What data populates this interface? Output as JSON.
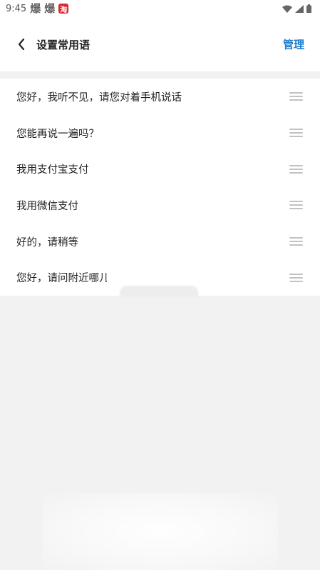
{
  "status_bar": {
    "time": "9:45",
    "notif_1": "爆",
    "notif_2": "爆",
    "notif_3": "淘"
  },
  "header": {
    "title": "设置常用语",
    "manage_label": "管理"
  },
  "phrases": [
    "您好，我听不见，请您对着手机说话",
    "您能再说一遍吗？",
    "我用支付宝支付",
    "我用微信支付",
    "好的，请稍等",
    "您好，请问附近哪儿"
  ],
  "colors": {
    "accent": "#1f7ccf",
    "background": "#f2f2f2",
    "handle": "#c2c2c2"
  },
  "icons": {
    "back": "chevron-left-icon",
    "drag": "drag-handle-icon",
    "wifi": "wifi-icon",
    "signal": "signal-icon",
    "battery": "battery-icon"
  }
}
